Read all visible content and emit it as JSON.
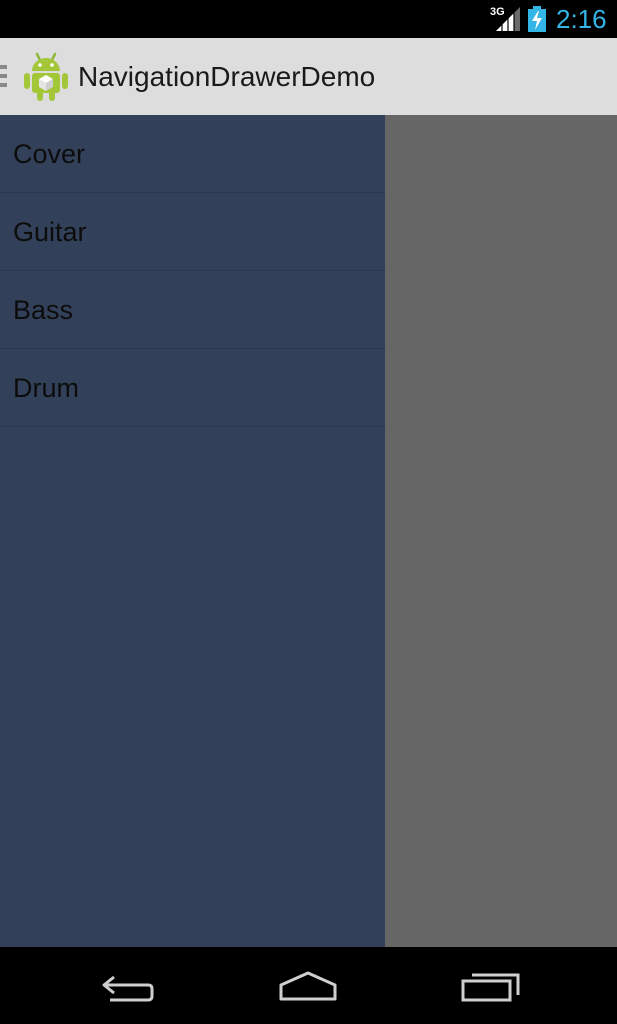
{
  "status_bar": {
    "network": "3G",
    "time": "2:16",
    "accent_color": "#33b5e5"
  },
  "action_bar": {
    "title": "NavigationDrawerDemo",
    "icon": "android-robot-icon"
  },
  "drawer": {
    "items": [
      {
        "label": "Cover"
      },
      {
        "label": "Guitar"
      },
      {
        "label": "Bass"
      },
      {
        "label": "Drum"
      }
    ],
    "background": "#324159"
  },
  "nav_bar": {
    "buttons": [
      "back-icon",
      "home-icon",
      "recent-apps-icon"
    ]
  }
}
